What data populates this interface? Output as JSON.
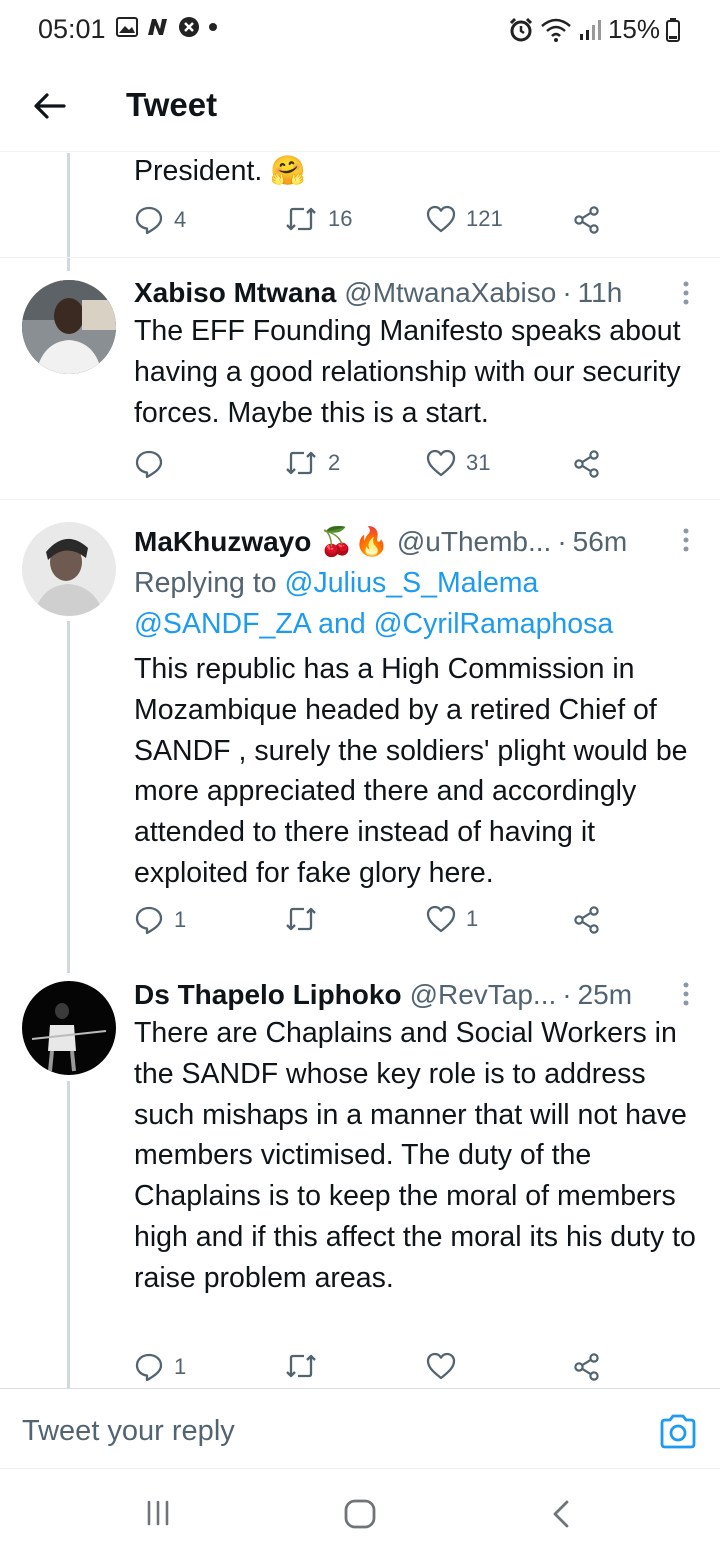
{
  "status_bar": {
    "time": "05:01",
    "left_icons": [
      "image-icon",
      "n-app-icon",
      "shield-x-icon",
      "dot-icon"
    ],
    "right_icons": [
      "alarm-icon",
      "wifi-icon",
      "signal-icon"
    ],
    "battery": "15%"
  },
  "header": {
    "title": "Tweet",
    "back_icon": "arrow-left-icon"
  },
  "tweets": [
    {
      "text": "President. 🤗",
      "replies": "4",
      "retweets": "16",
      "likes": "121"
    },
    {
      "name": "Xabiso Mtwana",
      "handle": "@MtwanaXabiso",
      "time": "11h",
      "text": "The EFF Founding Manifesto speaks about having a good relationship with our security forces. Maybe this is a start.",
      "replies": "",
      "retweets": "2",
      "likes": "31"
    },
    {
      "name": "MaKhuzwayo 🍒🔥",
      "handle": "@uThemb...",
      "time": "56m",
      "replying_prefix": "Replying to",
      "replying_user1": "@Julius_S_Malema",
      "replying_user2": "@SANDF_ZA",
      "replying_and": "and",
      "replying_user3": "@CyrilRamaphosa",
      "text": "This republic has a High Commission in Mozambique headed by a retired Chief of SANDF , surely the soldiers' plight would be more appreciated there and accordingly attended to there instead of having it exploited for fake glory here.",
      "replies": "1",
      "retweets": "",
      "likes": "1"
    },
    {
      "name": "Ds Thapelo Liphoko",
      "handle": "@RevTap...",
      "time": "25m",
      "text": "There are Chaplains and Social Workers in the SANDF whose key role is to address such mishaps in a manner that will not have members victimised. The duty of the Chaplains is to keep the moral of members high and if this affect the moral its his duty to raise problem areas.",
      "replies": "1",
      "retweets": "",
      "likes": ""
    }
  ],
  "reply_bar": {
    "placeholder": "Tweet your reply",
    "camera_icon": "camera-icon"
  },
  "nav_bar": {
    "icons": [
      "recent-apps-icon",
      "home-icon",
      "back-icon"
    ]
  },
  "colors": {
    "accent": "#1d9bf0",
    "text": "#0f1419",
    "muted": "#536471",
    "divider": "#eff3f4"
  }
}
